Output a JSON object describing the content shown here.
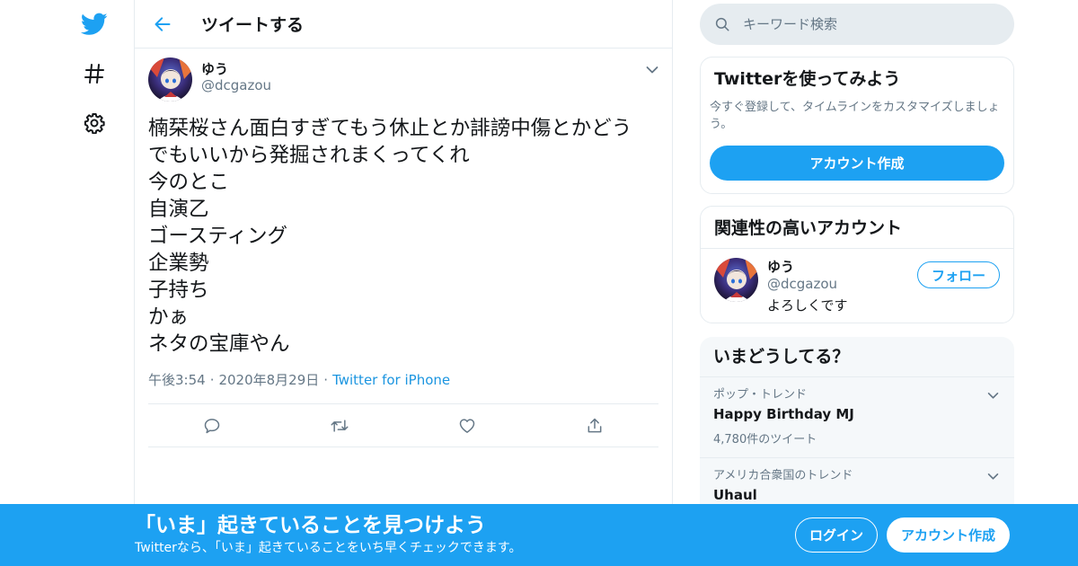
{
  "colors": {
    "accent": "#1da1f2",
    "text": "#14171a",
    "secondary": "#657786",
    "border": "#e6ecf0",
    "link": "#1b95e0"
  },
  "nav": {
    "icons": [
      "twitter-logo-icon",
      "hashtag-icon",
      "gear-icon"
    ]
  },
  "header": {
    "title": "ツイートする",
    "back_icon": "arrow-left-icon"
  },
  "tweet": {
    "author": {
      "name": "ゆう",
      "handle": "@dcgazou"
    },
    "lines": [
      "楠栞桜さん面白すぎてもう休止とか誹謗中傷とかどう",
      "でもいいから発掘されまくってくれ",
      "今のとこ",
      "自演乙",
      "ゴースティング",
      "企業勢",
      "子持ち",
      "かぁ",
      "ネタの宝庫やん"
    ],
    "time": "午後3:54",
    "date": "2020年8月29日",
    "source": "Twitter for iPhone",
    "actions": [
      "reply-icon",
      "retweet-icon",
      "like-icon",
      "share-icon"
    ]
  },
  "search": {
    "placeholder": "キーワード検索"
  },
  "signup_card": {
    "title": "Twitterを使ってみよう",
    "description": "今すぐ登録して、タイムラインをカスタマイズしましょう。",
    "button": "アカウント作成"
  },
  "related": {
    "title": "関連性の高いアカウント",
    "user": {
      "name": "ゆう",
      "handle": "@dcgazou",
      "bio": "よろしくです",
      "follow": "フォロー"
    }
  },
  "trends": {
    "title": "いまどうしてる？",
    "items": [
      {
        "context": "ポップ・トレンド",
        "name": "Happy Birthday MJ",
        "count": "4,780件のツイート"
      },
      {
        "context": "アメリカ合衆国のトレンド",
        "name": "Uhaul",
        "count": ""
      }
    ]
  },
  "banner": {
    "title": "「いま」起きていることを見つけよう",
    "subtitle": "Twitterなら、「いま」起きていることをいち早くチェックできます。",
    "login": "ログイン",
    "signup": "アカウント作成"
  }
}
